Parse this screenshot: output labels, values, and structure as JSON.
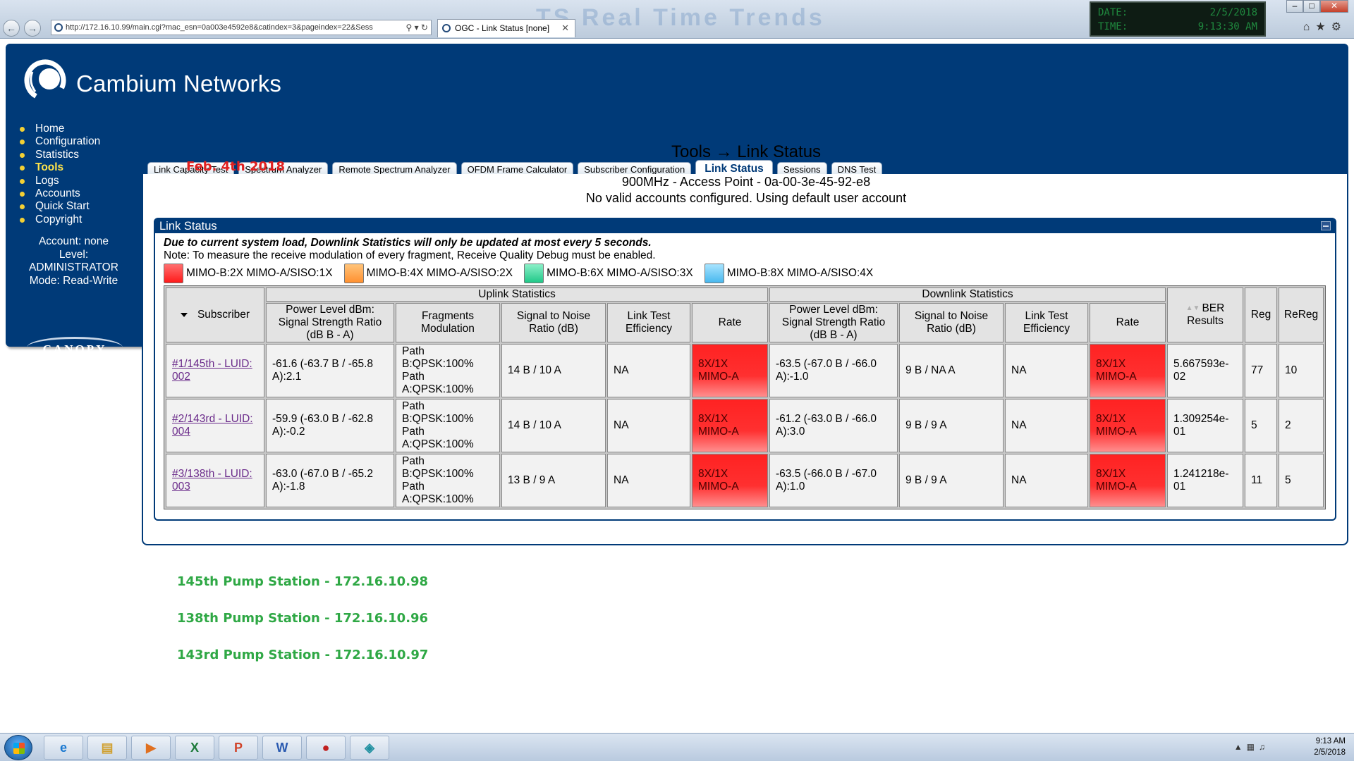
{
  "browser": {
    "url": "http://172.16.10.99/main.cgi?mac_esn=0a003e4592e8&catindex=3&pageindex=22&Sess",
    "tab_title": "OGC - Link Status [none]",
    "background_title": "TS Real Time Trends",
    "clock": {
      "date_label": "DATE:",
      "date_value": "2/5/2018",
      "time_label": "TIME:",
      "time_value": "9:13:30 AM"
    }
  },
  "brand": "Cambium Networks",
  "sidebar": {
    "items": [
      {
        "label": "Home"
      },
      {
        "label": "Configuration"
      },
      {
        "label": "Statistics"
      },
      {
        "label": "Tools",
        "active": true
      },
      {
        "label": "Logs"
      },
      {
        "label": "Accounts"
      },
      {
        "label": "Quick Start"
      },
      {
        "label": "Copyright"
      }
    ],
    "account_line": "Account: none",
    "level_label": "Level:",
    "level_value": "ADMINISTRATOR",
    "mode_line": "Mode: Read-Write",
    "canopy_logo": "CANOPY"
  },
  "tabs": [
    {
      "label": "Link Capacity Test"
    },
    {
      "label": "Spectrum Analyzer"
    },
    {
      "label": "Remote Spectrum Analyzer"
    },
    {
      "label": "OFDM Frame Calculator"
    },
    {
      "label": "Subscriber Configuration"
    },
    {
      "label": "Link Status",
      "active": true
    },
    {
      "label": "Sessions"
    },
    {
      "label": "DNS Test"
    }
  ],
  "annotation_date": "Feb. 4th 2018",
  "page_title": "Tools → Link Status",
  "ap_line": "900MHz - Access Point - 0a-00-3e-45-92-e8",
  "account_line": "No valid accounts configured. Using default user account",
  "panel": {
    "title": "Link Status",
    "notice": "Due to current system load, Downlink Statistics will only be updated at most every 5 seconds.",
    "note": "Note: To measure the receive modulation of every fragment, Receive Quality Debug must be enabled.",
    "legend": [
      {
        "label": "MIMO-B:2X MIMO-A/SISO:1X",
        "color": "#ff3333"
      },
      {
        "label": "MIMO-B:4X MIMO-A/SISO:2X",
        "color": "#ffa040"
      },
      {
        "label": "MIMO-B:6X MIMO-A/SISO:3X",
        "color": "#30d89a"
      },
      {
        "label": "MIMO-B:8X MIMO-A/SISO:4X",
        "color": "#5ec8f5"
      }
    ],
    "headers": {
      "subscriber": "Subscriber",
      "uplink_group": "Uplink Statistics",
      "downlink_group": "Downlink Statistics",
      "power_level": "Power Level dBm: Signal Strength Ratio (dB B - A)",
      "fragments": "Fragments Modulation",
      "snr": "Signal to Noise Ratio (dB)",
      "link_test": "Link Test Efficiency",
      "rate": "Rate",
      "ber": "BER Results",
      "reg": "Reg",
      "rereg": "ReReg"
    },
    "rows": [
      {
        "subscriber": "#1/145th - LUID: 002",
        "ul_power": "-61.6 (-63.7 B / -65.8 A):2.1",
        "ul_frag_1": "Path B:QPSK:100%",
        "ul_frag_2": "Path A:QPSK:100%",
        "ul_snr": "14 B / 10 A",
        "ul_lte": "NA",
        "ul_rate": "8X/1X MIMO-A",
        "dl_power": "-63.5 (-67.0 B / -66.0 A):-1.0",
        "dl_snr": "9 B / NA A",
        "dl_lte": "NA",
        "dl_rate": "8X/1X MIMO-A",
        "ber": "5.667593e-02",
        "reg": "77",
        "rereg": "10"
      },
      {
        "subscriber": "#2/143rd - LUID: 004",
        "ul_power": "-59.9 (-63.0 B / -62.8 A):-0.2",
        "ul_frag_1": "Path B:QPSK:100%",
        "ul_frag_2": "Path A:QPSK:100%",
        "ul_snr": "14 B / 10 A",
        "ul_lte": "NA",
        "ul_rate": "8X/1X MIMO-A",
        "dl_power": "-61.2 (-63.0 B / -66.0 A):3.0",
        "dl_snr": "9 B / 9 A",
        "dl_lte": "NA",
        "dl_rate": "8X/1X MIMO-A",
        "ber": "1.309254e-01",
        "reg": "5",
        "rereg": "2"
      },
      {
        "subscriber": "#3/138th - LUID: 003",
        "ul_power": "-63.0 (-67.0 B / -65.2 A):-1.8",
        "ul_frag_1": "Path B:QPSK:100%",
        "ul_frag_2": "Path A:QPSK:100%",
        "ul_snr": "13 B / 9 A",
        "ul_lte": "NA",
        "ul_rate": "8X/1X MIMO-A",
        "dl_power": "-63.5 (-66.0 B / -67.0 A):1.0",
        "dl_snr": "9 B / 9 A",
        "dl_lte": "NA",
        "dl_rate": "8X/1X MIMO-A",
        "ber": "1.241218e-01",
        "reg": "11",
        "rereg": "5"
      }
    ]
  },
  "stations": [
    "145th Pump Station - 172.16.10.98",
    "138th Pump Station - 172.16.10.96",
    "143rd Pump Station - 172.16.10.97"
  ],
  "taskbar": {
    "apps": [
      "internet-explorer-icon",
      "file-explorer-icon",
      "media-player-icon",
      "excel-icon",
      "powerpoint-icon",
      "word-icon",
      "app-icon",
      "app-icon"
    ],
    "time": "9:13 AM",
    "date": "2/5/2018"
  }
}
